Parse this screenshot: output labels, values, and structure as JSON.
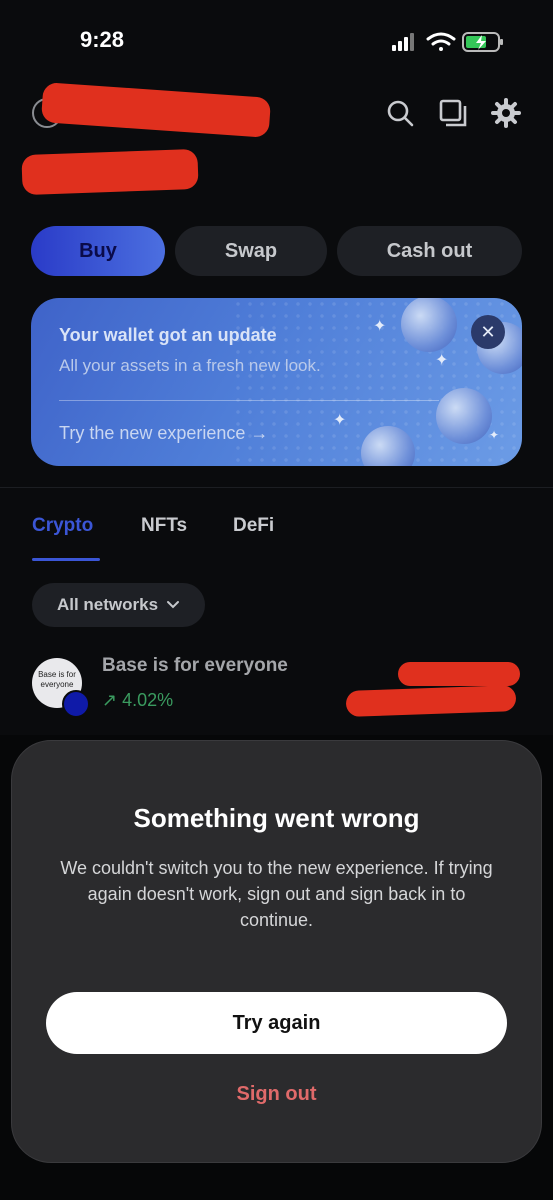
{
  "status_bar": {
    "time": "9:28"
  },
  "header": {
    "icons": [
      "search-icon",
      "copy-icon",
      "gear-icon"
    ]
  },
  "actions": {
    "buy": "Buy",
    "swap": "Swap",
    "cash_out": "Cash out"
  },
  "banner": {
    "title": "Your wallet got an update",
    "subtitle": "All your assets in a fresh new look.",
    "link": "Try the new experience →"
  },
  "tabs": {
    "crypto": "Crypto",
    "nfts": "NFTs",
    "defi": "DeFi"
  },
  "filter": {
    "networks": "All networks"
  },
  "asset": {
    "name": "Base is for everyone",
    "change": "↗ 4.02%",
    "logo_text": "Base is for everyone"
  },
  "modal": {
    "title": "Something went wrong",
    "body": "We couldn't switch you to the new experience. If trying again doesn't work, sign out and sign back in to continue.",
    "primary": "Try again",
    "secondary": "Sign out"
  },
  "colors": {
    "accent": "#3b56d6",
    "danger": "#e06a6a",
    "positive": "#3a9b5f"
  }
}
